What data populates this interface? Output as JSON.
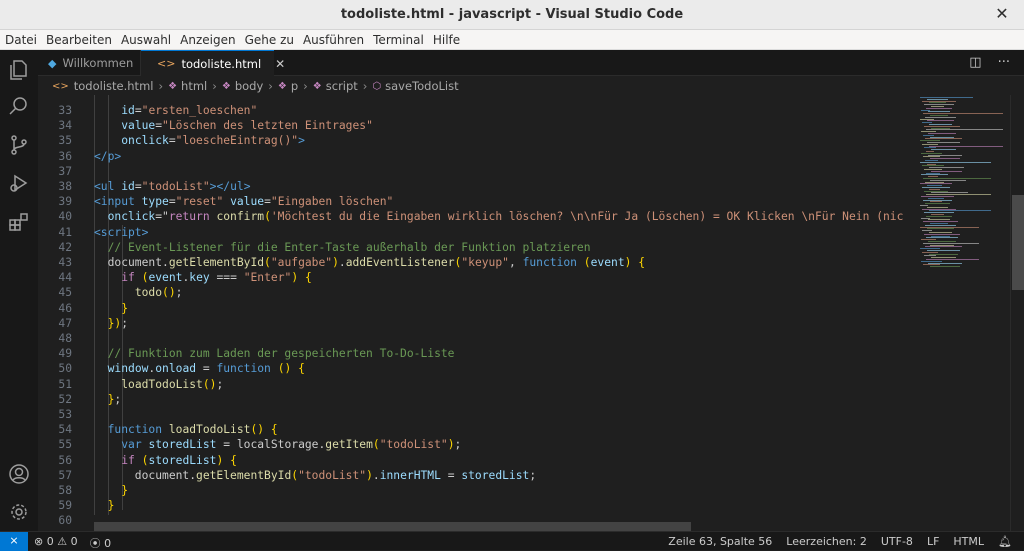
{
  "window": {
    "title": "todoliste.html - javascript - Visual Studio Code"
  },
  "menu": [
    "Datei",
    "Bearbeiten",
    "Auswahl",
    "Anzeigen",
    "Gehe zu",
    "Ausführen",
    "Terminal",
    "Hilfe"
  ],
  "tabs": [
    {
      "label": "Willkommen",
      "icon": "vscode-icon",
      "active": false
    },
    {
      "label": "todoliste.html",
      "icon": "html-file-icon",
      "active": true
    }
  ],
  "breadcrumb": [
    "todoliste.html",
    "html",
    "body",
    "p",
    "script",
    "saveTodoList"
  ],
  "code_lines": [
    {
      "n": 33,
      "text": "        id=\"ersten_loeschen\""
    },
    {
      "n": 34,
      "text": "        value=\"Löschen des letzten Eintrages\""
    },
    {
      "n": 35,
      "text": "        onclick=\"loescheEintrag()\">"
    },
    {
      "n": 36,
      "text": "    </p>"
    },
    {
      "n": 37,
      "text": ""
    },
    {
      "n": 38,
      "text": "    <ul id=\"todoList\"></ul>"
    },
    {
      "n": 39,
      "text": "    <input type=\"reset\" value=\"Eingaben löschen\""
    },
    {
      "n": 40,
      "text": "      onclick=\"return confirm('Möchtest du die Eingaben wirklich löschen? \\n\\nFür Ja (Löschen) = OK Klicken \\nFür Nein (nic"
    },
    {
      "n": 41,
      "text": "    <script>"
    },
    {
      "n": 42,
      "text": "      // Event-Listener für die Enter-Taste außerhalb der Funktion platzieren"
    },
    {
      "n": 43,
      "text": "      document.getElementById(\"aufgabe\").addEventListener(\"keyup\", function (event) {"
    },
    {
      "n": 44,
      "text": "        if (event.key === \"Enter\") {"
    },
    {
      "n": 45,
      "text": "          todo();"
    },
    {
      "n": 46,
      "text": "        }"
    },
    {
      "n": 47,
      "text": "      });"
    },
    {
      "n": 48,
      "text": ""
    },
    {
      "n": 49,
      "text": "      // Funktion zum Laden der gespeicherten To-Do-Liste"
    },
    {
      "n": 50,
      "text": "      window.onload = function () {"
    },
    {
      "n": 51,
      "text": "        loadTodoList();"
    },
    {
      "n": 52,
      "text": "      };"
    },
    {
      "n": 53,
      "text": ""
    },
    {
      "n": 54,
      "text": "      function loadTodoList() {"
    },
    {
      "n": 55,
      "text": "        var storedList = localStorage.getItem(\"todoList\");"
    },
    {
      "n": 56,
      "text": "        if (storedList) {"
    },
    {
      "n": 57,
      "text": "          document.getElementById(\"todoList\").innerHTML = storedList;"
    },
    {
      "n": 58,
      "text": "        }"
    },
    {
      "n": 59,
      "text": "      }"
    },
    {
      "n": 60,
      "text": ""
    }
  ],
  "status": {
    "remote_icon": "remote-icon",
    "errors": "0",
    "warnings": "0",
    "ports": "0",
    "position": "Zeile 63, Spalte 56",
    "indent": "Leerzeichen: 2",
    "encoding": "UTF-8",
    "eol": "LF",
    "language": "HTML",
    "bell_icon": "bell-icon"
  },
  "activity_icons": [
    "explorer-icon",
    "search-icon",
    "source-control-icon",
    "run-debug-icon",
    "extensions-icon",
    "account-icon",
    "settings-gear-icon"
  ]
}
